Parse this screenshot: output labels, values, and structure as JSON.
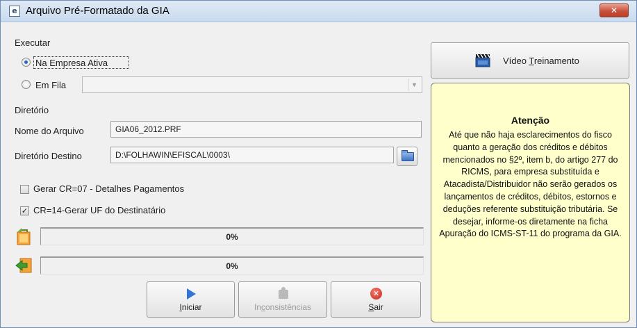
{
  "window": {
    "title": "Arquivo Pré-Formatado da GIA",
    "close_glyph": "✕"
  },
  "executar": {
    "group_label": "Executar",
    "option_active_label": "Na Empresa Ativa",
    "option_queue_label": "Em Fila",
    "queue_select_value": "",
    "selected": "Na Empresa Ativa"
  },
  "diretorio": {
    "group_label": "Diretório",
    "filename_label": "Nome do Arquivo",
    "filename_value": "GIA06_2012.PRF",
    "dest_label": "Diretório Destino",
    "dest_value": "D:\\FOLHAWIN\\EFISCAL\\0003\\"
  },
  "options": {
    "cr07_label": "Gerar CR=07 - Detalhes Pagamentos",
    "cr07_checked": false,
    "cr14_label": "CR=14-Gerar UF do Destinatário",
    "cr14_checked": true,
    "check_glyph": "✓"
  },
  "progress": {
    "bar1_text": "0%",
    "bar1_value": 0,
    "bar2_text": "0%",
    "bar2_value": 0
  },
  "buttons": {
    "iniciar_first": "I",
    "iniciar_rest": "niciar",
    "inconsistencias_pre": "In",
    "inconsistencias_ul": "c",
    "inconsistencias_post": "onsistências",
    "sair_first": "S",
    "sair_rest": "air",
    "sair_glyph": "✕"
  },
  "video_button": {
    "label_pre": "Vídeo ",
    "label_ul": "T",
    "label_post": "reinamento"
  },
  "attention": {
    "title": "Atenção",
    "body": "Até que não haja esclarecimentos do fisco quanto a geração dos créditos e débitos mencionados no §2º, item b, do artigo 277 do RICMS, para empresa substituída e Atacadista/Distribuidor não serão gerados os lançamentos de créditos, débitos, estornos e deduções referente substituição tributária. Se desejar, informe-os diretamente na ficha Apuração do ICMS-ST-11 do programa da GIA."
  },
  "colors": {
    "attention_bg": "#ffffcc",
    "title_bar": "#c9dbef",
    "close_button": "#c8503a"
  }
}
